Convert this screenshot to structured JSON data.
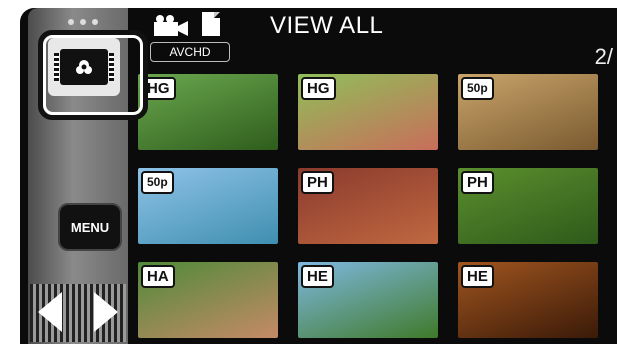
{
  "header": {
    "view_label": "VIEW ALL",
    "format_badge": "AVCHD",
    "page_indicator": "2/"
  },
  "side": {
    "menu_label": "MENU"
  },
  "thumbnails": [
    {
      "badge": "HG",
      "colors": [
        "#6aa84f",
        "#2f5d1c"
      ]
    },
    {
      "badge": "HG",
      "colors": [
        "#8fbf5a",
        "#c86e5a"
      ]
    },
    {
      "badge": "50p",
      "colors": [
        "#c9a46a",
        "#7a5a30"
      ]
    },
    {
      "badge": "50p",
      "colors": [
        "#8fc3e8",
        "#3f8fb0"
      ]
    },
    {
      "badge": "PH",
      "colors": [
        "#8a3a2e",
        "#c06840"
      ]
    },
    {
      "badge": "PH",
      "colors": [
        "#5b8f2e",
        "#2e5a1a"
      ]
    },
    {
      "badge": "HA",
      "colors": [
        "#4f8a3a",
        "#c58a66"
      ]
    },
    {
      "badge": "HE",
      "colors": [
        "#7fb8e0",
        "#3f7a2a"
      ]
    },
    {
      "badge": "HE",
      "colors": [
        "#a0551f",
        "#3a1a08"
      ]
    }
  ],
  "icons": [
    "video-camera-icon",
    "photo-icon",
    "picture-mode-icon",
    "left-arrow-icon",
    "right-arrow-icon"
  ]
}
